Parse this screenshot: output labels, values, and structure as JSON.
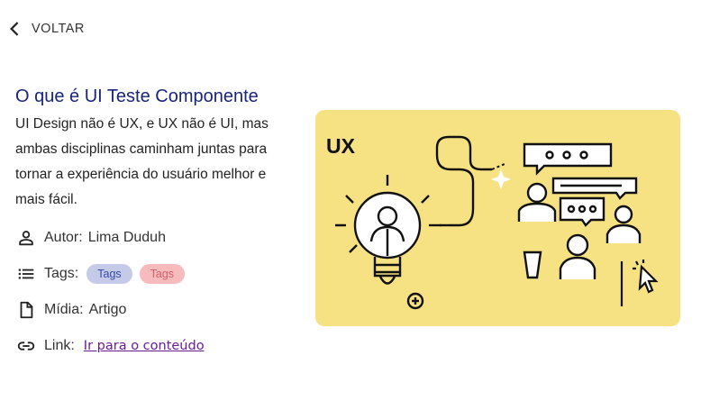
{
  "nav": {
    "back_label": "VOLTAR"
  },
  "article": {
    "title": "O que é UI Teste Componente",
    "description": "UI Design não é UX, e UX não é UI, mas ambas disciplinas caminham juntas para tornar a experiência do usuário melhor e mais fácil."
  },
  "meta": {
    "author_label": "Autor:",
    "author": "Lima Duduh",
    "tags_label": "Tags:",
    "tags": [
      "Tags",
      "Tags"
    ],
    "media_label": "Mídia:",
    "media": "Artigo",
    "link_label": "Link:",
    "link_text": "Ir para o conteúdo"
  },
  "illustration": {
    "badge": "UX"
  },
  "colors": {
    "title": "#1a237e",
    "illustration_bg": "#f7e283",
    "tag_blue_bg": "#c5cae9",
    "tag_pink_bg": "#f8bbbd",
    "link": "#6a1b9a"
  }
}
